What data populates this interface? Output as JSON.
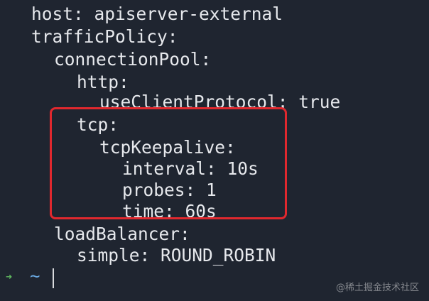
{
  "terminal": {
    "cut_top_line": "- - -",
    "lines": [
      "host: apiserver-external",
      "trafficPolicy:",
      "connectionPool:",
      "http:",
      "useClientProtocol: true",
      "tcp:",
      "tcpKeepalive:",
      "interval: 10s",
      "probes: 1",
      "time: 60s",
      "loadBalancer:",
      "simple: ROUND_ROBIN"
    ],
    "prompt_arrow": "➜",
    "prompt_dir": "~"
  },
  "highlight_color": "#e0282e",
  "watermark": "@稀土掘金技术社区"
}
